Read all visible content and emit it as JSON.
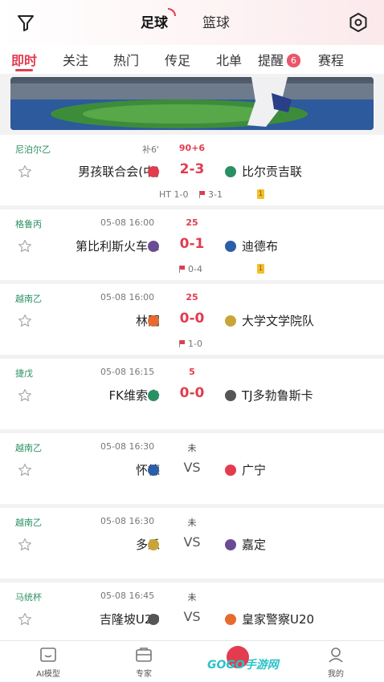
{
  "header": {
    "sport_tabs": [
      {
        "label": "足球",
        "active": true
      },
      {
        "label": "篮球",
        "active": false
      }
    ]
  },
  "nav": {
    "items": [
      "即时",
      "关注",
      "热门",
      "传足",
      "北单",
      "提醒",
      "赛程"
    ],
    "active": "即时",
    "reminder_badge": "6"
  },
  "matches": [
    {
      "league": "尼泊尔乙",
      "time": "补6'",
      "minute": "90+6",
      "home": "男孩联合会(中)",
      "score": "2-3",
      "away": "比尔贡吉联",
      "sub_ht": "HT 1-0",
      "sub_corner": "3-1",
      "yellow": "1",
      "state": "live"
    },
    {
      "league": "格鲁丙",
      "time": "05-08 16:00",
      "minute": "25",
      "home": "第比利斯火车…",
      "score": "0-1",
      "away": "迪德布",
      "sub_ht": "",
      "sub_corner": "0-4",
      "yellow": "1",
      "state": "live"
    },
    {
      "league": "越南乙",
      "time": "05-08 16:00",
      "minute": "25",
      "home": "林同",
      "score": "0-0",
      "away": "大学文学院队",
      "sub_ht": "",
      "sub_corner": "1-0",
      "yellow": "",
      "state": "live"
    },
    {
      "league": "捷戊",
      "time": "05-08 16:15",
      "minute": "5",
      "home": "FK维索卡",
      "score": "0-0",
      "away": "TJ多勃鲁斯卡",
      "sub_ht": "",
      "sub_corner": "",
      "yellow": "",
      "state": "live"
    },
    {
      "league": "越南乙",
      "time": "05-08 16:30",
      "minute": "未",
      "home": "怀德",
      "score": "VS",
      "away": "广宁",
      "sub_ht": "",
      "sub_corner": "",
      "yellow": "",
      "state": "pending"
    },
    {
      "league": "越南乙",
      "time": "05-08 16:30",
      "minute": "未",
      "home": "多乐",
      "score": "VS",
      "away": "嘉定",
      "sub_ht": "",
      "sub_corner": "",
      "yellow": "",
      "state": "pending"
    },
    {
      "league": "马统杯",
      "time": "05-08 16:45",
      "minute": "未",
      "home": "吉隆坡U20",
      "score": "VS",
      "away": "皇家警察U20",
      "sub_ht": "",
      "sub_corner": "",
      "yellow": "",
      "state": "pending"
    }
  ],
  "bottom_tabs": [
    {
      "label": "AI模型",
      "icon": "ai-model-icon"
    },
    {
      "label": "专家",
      "icon": "expert-icon"
    },
    {
      "label": "比分",
      "icon": "score-icon"
    },
    {
      "label": "",
      "icon": ""
    },
    {
      "label": "我的",
      "icon": "profile-icon"
    }
  ],
  "watermark": {
    "text1": "GO",
    "text2": "GO",
    "text3": "手游网"
  },
  "colors": {
    "accent": "#e23c4e",
    "league": "#2a8f63",
    "yellow_card": "#f3bf2c"
  }
}
